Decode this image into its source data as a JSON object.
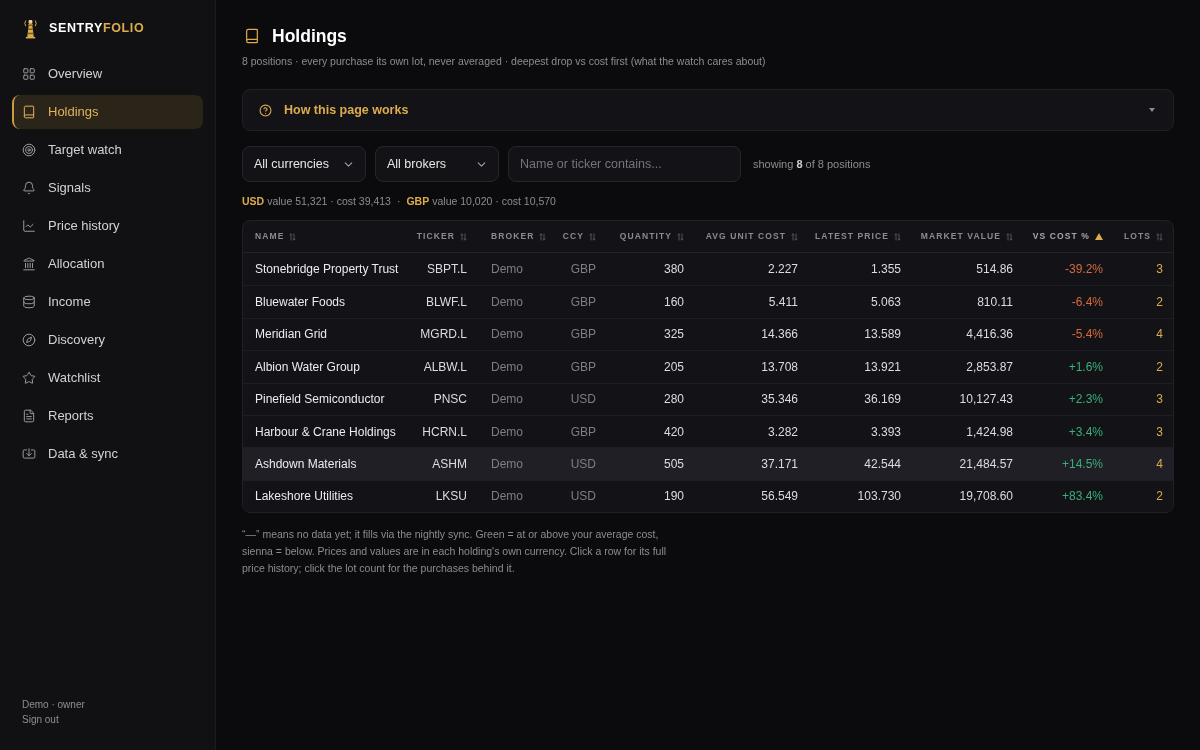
{
  "sidebar": {
    "brand": {
      "part_1": "SENTRY",
      "part_2": "FOLIO"
    },
    "nav": [
      {
        "label": "Overview",
        "selected": false
      },
      {
        "label": "Holdings",
        "selected": true
      },
      {
        "label": "Target watch",
        "selected": false
      },
      {
        "label": "Signals",
        "selected": false
      },
      {
        "label": "Price history",
        "selected": false
      },
      {
        "label": "Allocation",
        "selected": false
      },
      {
        "label": "Income",
        "selected": false
      },
      {
        "label": "Discovery",
        "selected": false
      },
      {
        "label": "Watchlist",
        "selected": false
      },
      {
        "label": "Reports",
        "selected": false
      },
      {
        "label": "Data & sync",
        "selected": false
      }
    ],
    "footer": {
      "user": "Demo · owner",
      "sign_out": "Sign out"
    }
  },
  "page": {
    "title": "Holdings",
    "subtitle": "8 positions · every purchase its own lot, never averaged · deepest drop vs cost first (what the watch cares about)"
  },
  "help_panel": {
    "title": "How this page works",
    "expanded": false
  },
  "filters": {
    "currency": {
      "value": "All currencies"
    },
    "broker": {
      "value": "All brokers"
    },
    "search": {
      "placeholder": "Name or ticker contains..."
    },
    "count": "showing **8** of 8 positions"
  },
  "totals": [
    {
      "currency": "USD",
      "text": "value 51,321 · cost 39,413"
    },
    {
      "currency": "GBP",
      "text": "value 10,020 · cost 10,570"
    }
  ],
  "totals_separator": "·",
  "table": {
    "columns": [
      {
        "label": "NAME",
        "sorted": false
      },
      {
        "label": "TICKER",
        "sorted": false
      },
      {
        "label": "BROKER",
        "sorted": false
      },
      {
        "label": "CCY",
        "sorted": false
      },
      {
        "label": "QUANTITY",
        "sorted": false
      },
      {
        "label": "AVG UNIT COST",
        "sorted": false
      },
      {
        "label": "LATEST PRICE",
        "sorted": false
      },
      {
        "label": "MARKET VALUE",
        "sorted": false
      },
      {
        "label": "VS COST %",
        "sorted": true
      },
      {
        "label": "LOTS",
        "sorted": false
      }
    ],
    "rows": [
      {
        "name": "Stonebridge Property Trust",
        "ticker": "SBPT.L",
        "broker": "Demo",
        "ccy": "GBP",
        "quantity": "380",
        "avg_unit_cost": "2.227",
        "latest_price": "1.355",
        "market_value": "514.86",
        "vs_cost": "-39.2%",
        "color": "#d66a3f",
        "lots": "3",
        "highlighted": false
      },
      {
        "name": "Bluewater Foods",
        "ticker": "BLWF.L",
        "broker": "Demo",
        "ccy": "GBP",
        "quantity": "160",
        "avg_unit_cost": "5.411",
        "latest_price": "5.063",
        "market_value": "810.11",
        "vs_cost": "-6.4%",
        "color": "#d66a3f",
        "lots": "2",
        "highlighted": false
      },
      {
        "name": "Meridian Grid",
        "ticker": "MGRD.L",
        "broker": "Demo",
        "ccy": "GBP",
        "quantity": "325",
        "avg_unit_cost": "14.366",
        "latest_price": "13.589",
        "market_value": "4,416.36",
        "vs_cost": "-5.4%",
        "color": "#d66a3f",
        "lots": "4",
        "highlighted": false
      },
      {
        "name": "Albion Water Group",
        "ticker": "ALBW.L",
        "broker": "Demo",
        "ccy": "GBP",
        "quantity": "205",
        "avg_unit_cost": "13.708",
        "latest_price": "13.921",
        "market_value": "2,853.87",
        "vs_cost": "+1.6%",
        "color": "#3aae78",
        "lots": "2",
        "highlighted": false
      },
      {
        "name": "Pinefield Semiconductor",
        "ticker": "PNSC",
        "broker": "Demo",
        "ccy": "USD",
        "quantity": "280",
        "avg_unit_cost": "35.346",
        "latest_price": "36.169",
        "market_value": "10,127.43",
        "vs_cost": "+2.3%",
        "color": "#3aae78",
        "lots": "3",
        "highlighted": false
      },
      {
        "name": "Harbour & Crane Holdings",
        "ticker": "HCRN.L",
        "broker": "Demo",
        "ccy": "GBP",
        "quantity": "420",
        "avg_unit_cost": "3.282",
        "latest_price": "3.393",
        "market_value": "1,424.98",
        "vs_cost": "+3.4%",
        "color": "#3aae78",
        "lots": "3",
        "highlighted": false
      },
      {
        "name": "Ashdown Materials",
        "ticker": "ASHM",
        "broker": "Demo",
        "ccy": "USD",
        "quantity": "505",
        "avg_unit_cost": "37.171",
        "latest_price": "42.544",
        "market_value": "21,484.57",
        "vs_cost": "+14.5%",
        "color": "#3aae78",
        "lots": "4",
        "highlighted": true
      },
      {
        "name": "Lakeshore Utilities",
        "ticker": "LKSU",
        "broker": "Demo",
        "ccy": "USD",
        "quantity": "190",
        "avg_unit_cost": "56.549",
        "latest_price": "103.730",
        "market_value": "19,708.60",
        "vs_cost": "+83.4%",
        "color": "#3aae78",
        "lots": "2",
        "highlighted": false
      }
    ]
  },
  "note": "“—” means no data yet; it fills via the nightly sync. Green = at or above your average cost, sienna = below. Prices and values are in each holding's own currency. Click a row for its full price history; click the lot count for the purchases behind it."
}
